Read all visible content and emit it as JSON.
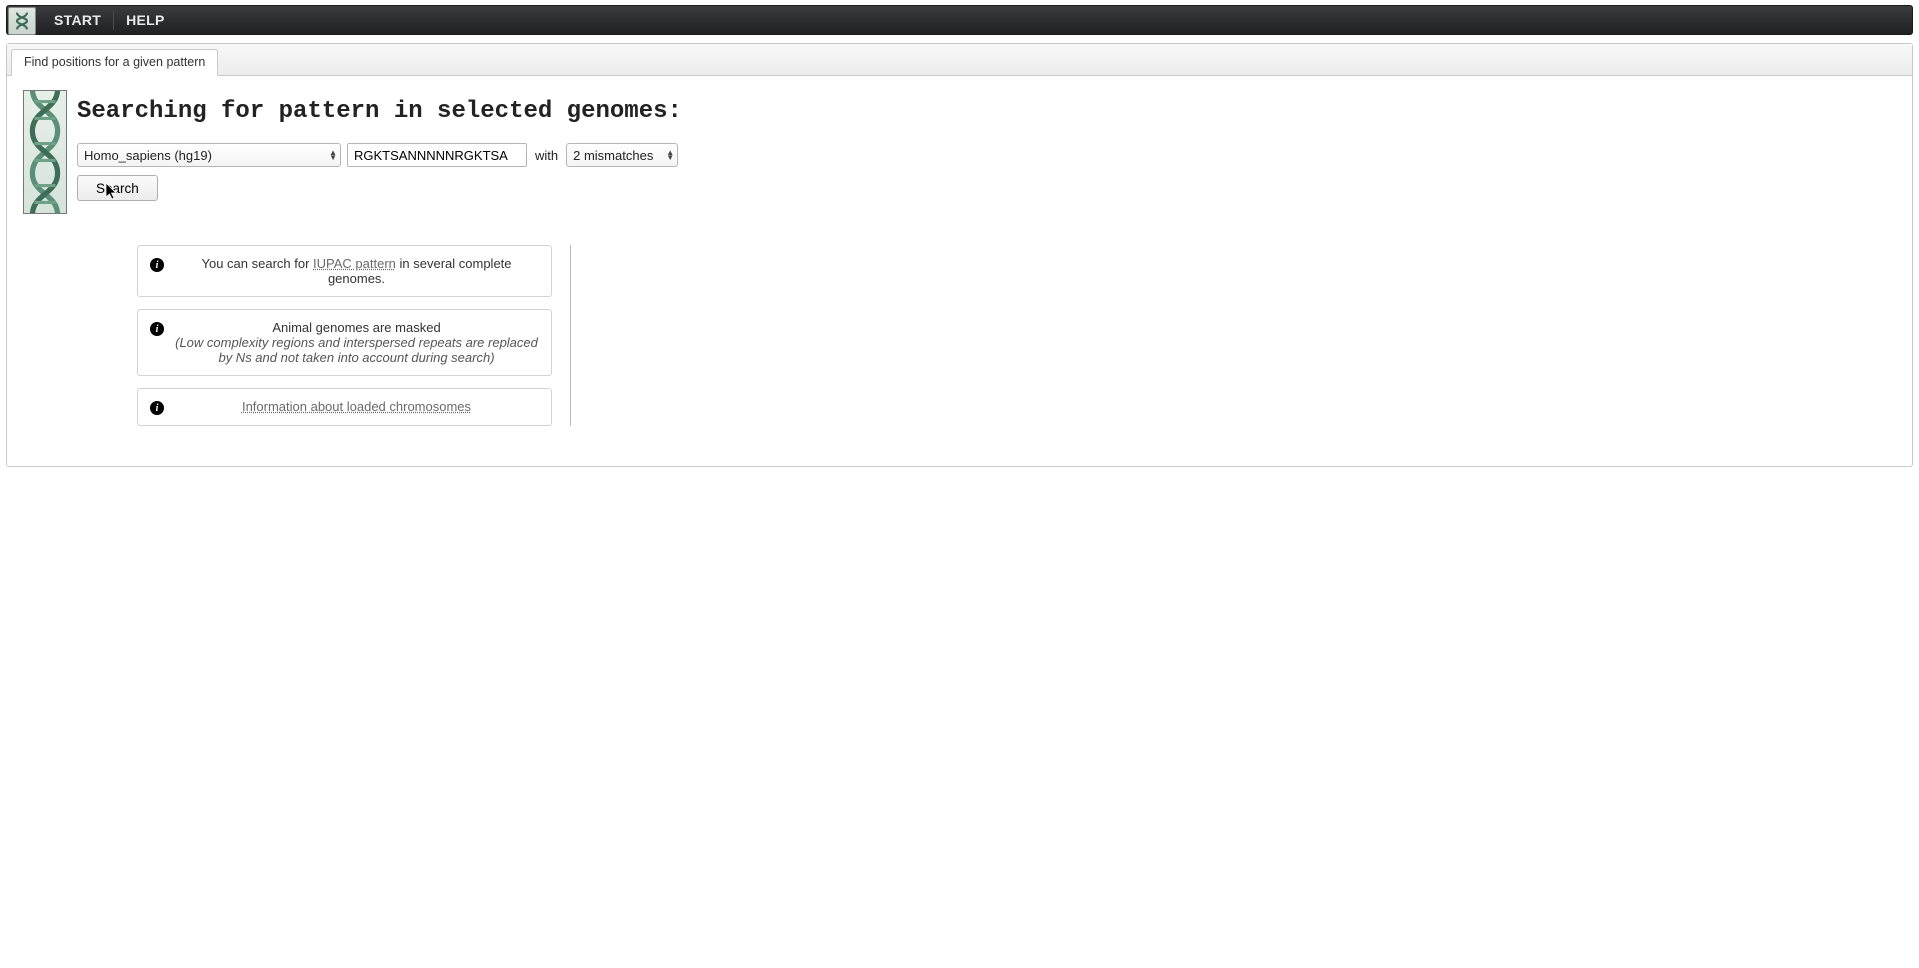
{
  "menubar": {
    "items": [
      {
        "label": "START"
      },
      {
        "label": "HELP"
      }
    ]
  },
  "tab": {
    "label": "Find positions for a given pattern"
  },
  "heading": "Searching for pattern in selected genomes:",
  "form": {
    "genome_selected": "Homo_sapiens (hg19)",
    "pattern_value": "RGKTSANNNNNRGKTSA",
    "with_label": "with",
    "mismatch_selected": "2 mismatches",
    "search_label": "Search"
  },
  "info": {
    "box1_pre": "You can search for ",
    "box1_link": "IUPAC pattern",
    "box1_post": " in several complete genomes.",
    "box2_line1": "Animal genomes are masked",
    "box2_line2": "(Low complexity regions and interspersed repeats are replaced by Ns and not taken into account during search)",
    "box3_link": "Information about loaded chromosomes"
  }
}
